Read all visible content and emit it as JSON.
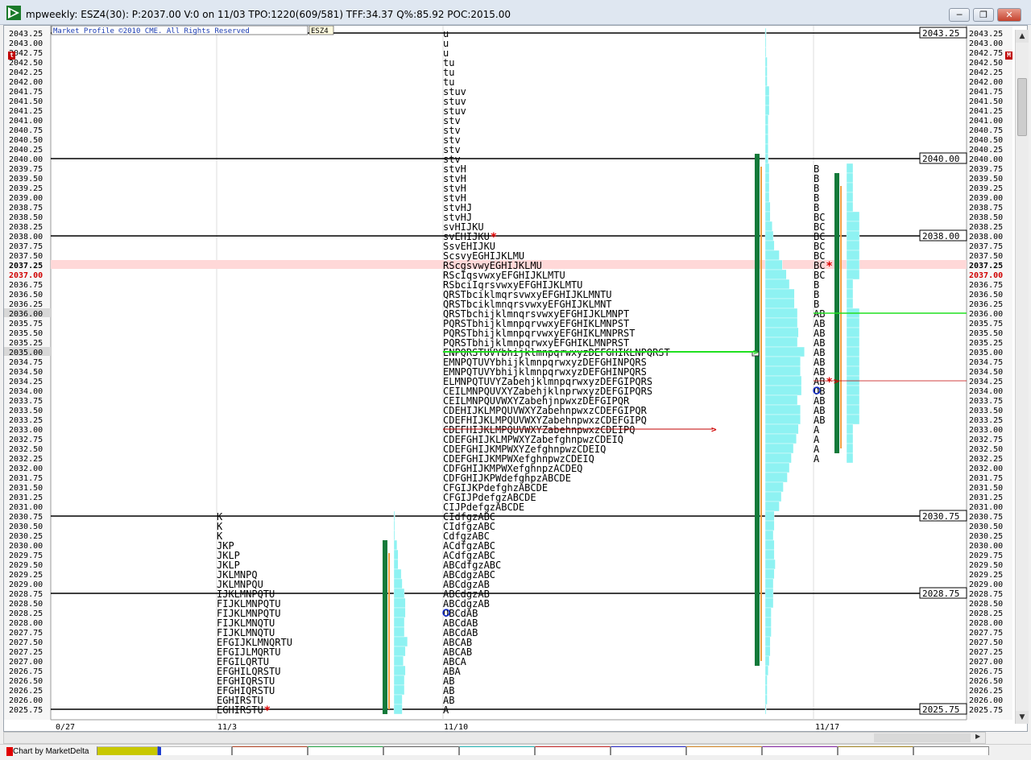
{
  "window": {
    "title": "mpweekly: ESZ4(30): P:2037.00 V:0 on 11/03 TPO:1220(609/581) TFF:34.37 Q%:85.92 POC:2015.00",
    "minimize_label": "─",
    "restore_label": "❐",
    "close_label": "✕"
  },
  "chart": {
    "copyright": "Market Profile ©2010 CME. All Rights Reserved",
    "symbol": "ESZ4",
    "left_marker": "t",
    "right_marker": "M",
    "current_price": "2037.00",
    "poc_price": "2037.25",
    "price_labels": [
      "2043.25",
      "2043.00",
      "2042.75",
      "2042.50",
      "2042.25",
      "2042.00",
      "2041.75",
      "2041.50",
      "2041.25",
      "2041.00",
      "2040.75",
      "2040.50",
      "2040.25",
      "2040.00",
      "2039.75",
      "2039.50",
      "2039.25",
      "2039.00",
      "2038.75",
      "2038.50",
      "2038.25",
      "2038.00",
      "2037.75",
      "2037.50",
      "2037.25",
      "2037.00",
      "2036.75",
      "2036.50",
      "2036.25",
      "2036.00",
      "2035.75",
      "2035.50",
      "2035.25",
      "2035.00",
      "2034.75",
      "2034.50",
      "2034.25",
      "2034.00",
      "2033.75",
      "2033.50",
      "2033.25",
      "2033.00",
      "2032.75",
      "2032.50",
      "2032.25",
      "2032.00",
      "2031.75",
      "2031.50",
      "2031.25",
      "2031.00",
      "2030.75",
      "2030.50",
      "2030.25",
      "2030.00",
      "2029.75",
      "2029.50",
      "2029.25",
      "2029.00",
      "2028.75",
      "2028.50",
      "2028.25",
      "2028.00",
      "2027.75",
      "2027.50",
      "2027.25",
      "2027.00",
      "2026.75",
      "2026.50",
      "2026.25",
      "2026.00",
      "2025.75"
    ],
    "reference_levels": [
      "2043.25",
      "2040.00",
      "2038.00",
      "2030.75",
      "2028.75",
      "2025.75"
    ],
    "highlight_levels": [
      "2036.00",
      "2035.00"
    ],
    "x_labels": [
      "0/27",
      "11/3",
      "11/10",
      "11/17"
    ],
    "profiles": [
      {
        "name": "profile-11-3",
        "top_price": 2030.75,
        "rows": [
          "K",
          "K",
          "K",
          "JKP",
          "JKLP",
          "JKLP",
          "JKLMNPQ",
          "JKLMNPQU",
          "IJKLMNPQTU",
          "FIJKLMNPQTU",
          "FIJKLMNPQTU",
          "FIJKLMNQTU",
          "FIJKLMNQTU",
          "EFGIJKLMNQRTU",
          "EFGIJLMQRTU",
          "EFGILQRTU",
          "EFGHILQRSTU",
          "EFGHIQRSTU",
          "EFGHIQRSTU",
          "EGHIRSTU",
          "EGHIRSTU*"
        ]
      },
      {
        "name": "profile-11-10",
        "top_price": 2043.25,
        "rows": [
          "u",
          "u",
          "u",
          "tu",
          "tu",
          "tu",
          "stuv",
          "stuv",
          "stuv",
          "stv",
          "stv",
          "stv",
          "stv",
          "stv",
          "stvH",
          "stvH",
          "stvH",
          "stvH",
          "stvHJ",
          "stvHJ",
          "svHIJKU",
          "svEHIJKU*",
          "SsvEHIJKU",
          "ScsvyEGHIJKLMU",
          "RScgsvwyEGHIJKLMU",
          "RScIqsvwxyEFGHIJKLMTU",
          "RSbciIqrsvwxyEFGHIJKLMTU",
          "QRSTbciklmqrsvwxyEFGHIJKLMNTU",
          "QRSTbciklmnqrsvwxyEFGHIJKLMNT",
          "QRSTbchijklmnqrsvwxyEFGHIJKLMNPT",
          "PQRSTbhijklmnpqrvwxyEFGHIKLMNPST",
          "PQRSTbhijklmnpqrvwxyEFGHIKLMNPRST",
          "PQRSTbhijklmnpqrwxyEFGHIKLMNPRST",
          "ENPQRSTUVYbhijklmnpqrwxyzDEFGHIKLNPQRST",
          "EMNPQTUVYbhijklmnpqrwxyzDEFGHINPQRS",
          "EMNPQTUVYbhijklmnpqrwxyzDEFGHINPQRS",
          "ELMNPQTUVYZabehjklmnpqrwxyzDEFGIPQRS",
          "CEILMNPQUVXYZabehjklnprwxyzDEFGIPQRS",
          "CEILMNPQUVWXYZabehjnpwxzDEFGIPQR",
          "CDEHIJKLMPQUVWXYZabehnpwxzCDEFGIPQR",
          "CDEFHIJKLMPQUVWXYZabehnpwxzCDEFGIPQ",
          "CDEFHIJKLMPQUVWXYZabehnpwxzCDEIPQ",
          "CDEFGHIJKLMPWXYZabefghnpwzCDEIQ",
          "CDEFGHIJKMPWXYZefghnpwzCDEIQ",
          "CDEFGHIJKMPWXefghnpwzCDEIQ",
          "CDFGHIJKMPWXefghnpzACDEQ",
          "CDFGHIJKPWdefghpzABCDE",
          "CFGIJKPdefghzABCDE",
          "CFGIJPdefgzABCDE",
          "CIJPdefgzABCDE",
          "CIdfgzABC",
          "CIdfgzABC",
          "CdfgzABC",
          "ACdfgzABC",
          "ACdfgzABC",
          "ABCdfgzABC",
          "ABCdgzABC",
          "ABCdgzAB",
          "ABCdgzAB",
          "ABCdgzAB",
          "OBCdAB",
          "ABCdAB",
          "ABCdAB",
          "ABCAB",
          "ABCAB",
          "ABCA",
          "ABA",
          "AB",
          "AB",
          "AB",
          "A"
        ]
      },
      {
        "name": "profile-11-17",
        "top_price": 2039.75,
        "rows": [
          "B",
          "B",
          "B",
          "B",
          "B",
          "BC",
          "BC",
          "BC",
          "BC",
          "BC",
          "BC*",
          "BC",
          "B",
          "B",
          "B",
          "AB",
          "AB",
          "AB",
          "AB",
          "AB",
          "AB",
          "AB",
          "AB*",
          "OB",
          "AB",
          "AB",
          "AB",
          "A",
          "A",
          "A",
          "A"
        ]
      }
    ]
  },
  "bottom": {
    "credit": "Chart by MarketDelta"
  }
}
